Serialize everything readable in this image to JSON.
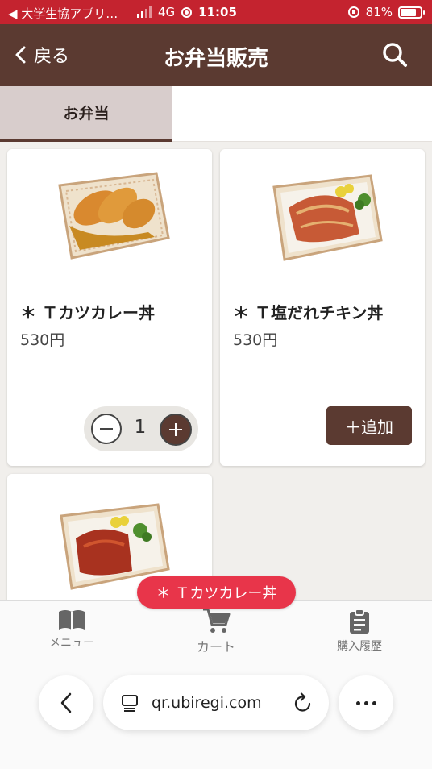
{
  "status_bar": {
    "back_app": "◀ 大学生協アプリ…",
    "network": "4G",
    "time": "11:05",
    "battery": "81%",
    "battery_level": 0.81
  },
  "header": {
    "back_label": "戻る",
    "title": "お弁当販売"
  },
  "tabs": [
    {
      "label": "お弁当",
      "active": true
    }
  ],
  "products": [
    {
      "name": "＊ Ｔカツカレー丼",
      "price": "530円",
      "quantity": "1"
    },
    {
      "name": "＊ Ｔ塩だれチキン丼",
      "price": "530円",
      "add_label": "＋追加"
    },
    {
      "name": ""
    }
  ],
  "cart_toast": "＊ Ｔカツカレー丼",
  "bottom_nav": {
    "menu": "メニュー",
    "cart": "カート",
    "history": "購入履歴"
  },
  "browser": {
    "url": "qr.ubiregi.com"
  },
  "colors": {
    "header": "#5b3a31",
    "status_bar": "#c4232f",
    "accent": "#e8354a"
  }
}
